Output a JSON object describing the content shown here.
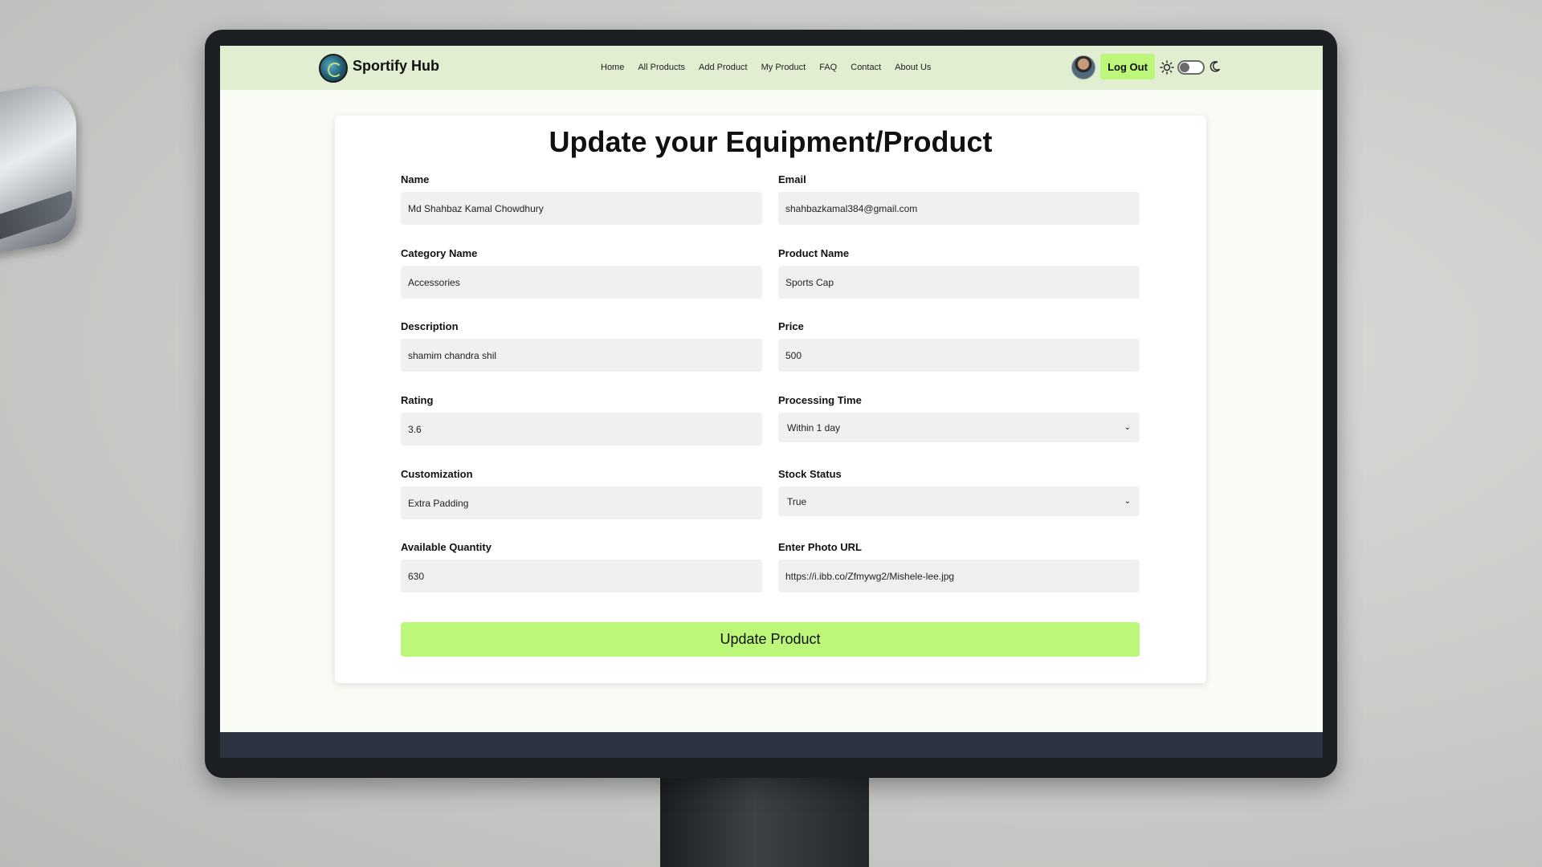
{
  "brand": {
    "name": "Sportify Hub"
  },
  "nav": {
    "links": [
      "Home",
      "All Products",
      "Add Product",
      "My Product",
      "FAQ",
      "Contact",
      "About Us"
    ],
    "logout_label": "Log Out",
    "theme_toggle": {
      "state": "light",
      "icons": [
        "sun-icon",
        "moon-icon"
      ]
    }
  },
  "form": {
    "title": "Update your Equipment/Product",
    "fields": {
      "name": {
        "label": "Name",
        "value": "Md Shahbaz Kamal Chowdhury"
      },
      "email": {
        "label": "Email",
        "value": "shahbazkamal384@gmail.com"
      },
      "category": {
        "label": "Category Name",
        "value": "Accessories"
      },
      "product_name": {
        "label": "Product Name",
        "value": "Sports Cap"
      },
      "description": {
        "label": "Description",
        "value": "shamim chandra shil"
      },
      "price": {
        "label": "Price",
        "value": "500"
      },
      "rating": {
        "label": "Rating",
        "value": "3.6"
      },
      "processing_time": {
        "label": "Processing Time",
        "value": "Within 1 day"
      },
      "customization": {
        "label": "Customization",
        "value": "Extra Padding"
      },
      "stock_status": {
        "label": "Stock Status",
        "value": "True"
      },
      "quantity": {
        "label": "Available Quantity",
        "value": "630"
      },
      "photo_url": {
        "label": "Enter Photo URL",
        "value": "https://i.ibb.co/Zfmywg2/Mishele-lee.jpg"
      }
    },
    "submit_label": "Update Product"
  },
  "colors": {
    "accent": "#bdf77a",
    "navbar_bg": "#e1eed2",
    "page_bg": "#f9fcf5",
    "input_bg": "#f0f0f0",
    "footer_bg": "#2d3341"
  }
}
